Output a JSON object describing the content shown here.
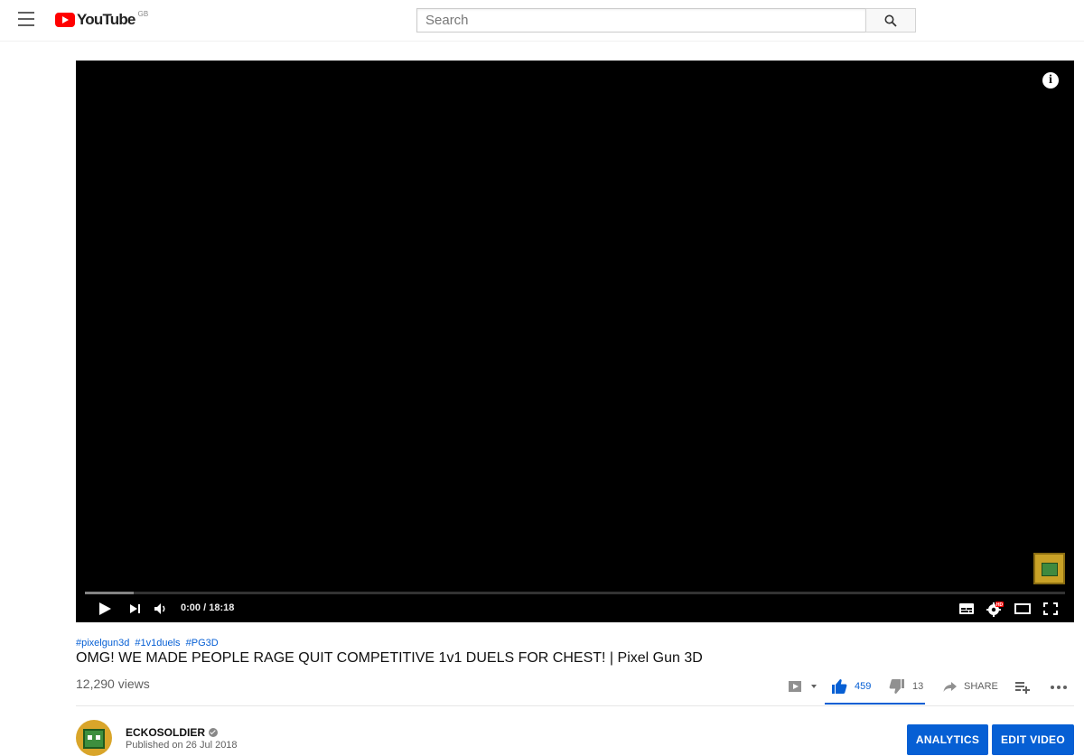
{
  "header": {
    "logo_text": "YouTube",
    "country_code": "GB",
    "search_placeholder": "Search",
    "search_value": ""
  },
  "player": {
    "current_time": "0:00",
    "separator": "/",
    "duration": "18:18",
    "progress_fraction": 0.0,
    "buffered_fraction": 0.05,
    "hd_badge": "HD"
  },
  "video": {
    "hashtags": [
      "#pixelgun3d",
      "#1v1duels",
      "#PG3D"
    ],
    "title": "OMG! WE MADE PEOPLE RAGE QUIT COMPETITIVE 1v1 DUELS FOR CHEST! | Pixel Gun 3D",
    "views": "12,290 views",
    "likes": "459",
    "dislikes": "13",
    "share_label": "SHARE"
  },
  "channel": {
    "name": "ECKOSOLDIER",
    "published": "Published on 26 Jul 2018"
  },
  "buttons": {
    "analytics": "ANALYTICS",
    "edit_video": "EDIT VIDEO"
  },
  "colors": {
    "brand_red": "#ff0000",
    "accent_blue": "#065fd4"
  },
  "icons": [
    "menu-icon",
    "search-icon",
    "info-icon",
    "play-icon",
    "next-icon",
    "volume-icon",
    "subtitles-icon",
    "settings-icon",
    "theater-icon",
    "fullscreen-icon",
    "playlist-icon",
    "like-icon",
    "dislike-icon",
    "share-icon",
    "add-to-playlist-icon",
    "more-icon",
    "verified-icon"
  ]
}
